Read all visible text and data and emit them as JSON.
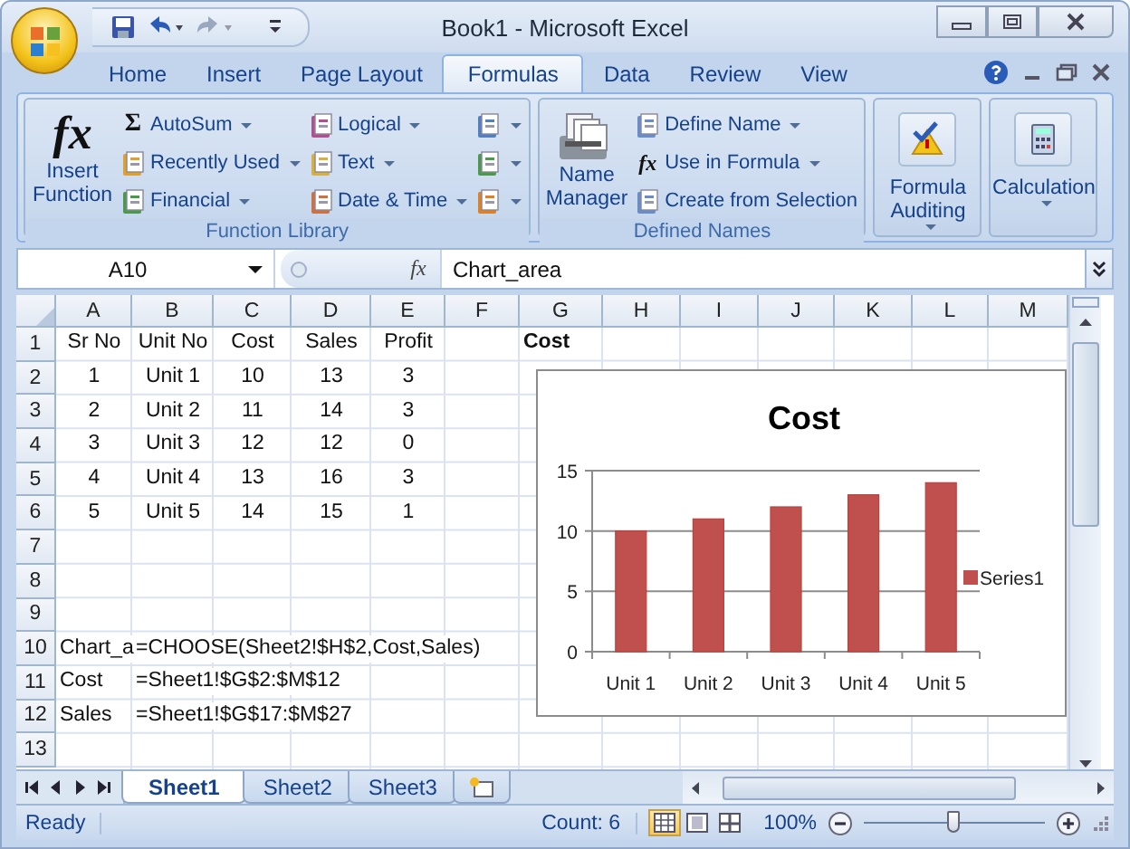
{
  "window": {
    "title": "Book1 - Microsoft Excel"
  },
  "ribbon_tabs": [
    {
      "label": "Home",
      "selected": false
    },
    {
      "label": "Insert",
      "selected": false
    },
    {
      "label": "Page Layout",
      "selected": false
    },
    {
      "label": "Formulas",
      "selected": true
    },
    {
      "label": "Data",
      "selected": false
    },
    {
      "label": "Review",
      "selected": false
    },
    {
      "label": "View",
      "selected": false
    }
  ],
  "ribbon_groups": [
    {
      "label": "Function Library",
      "large": [
        {
          "label": "Insert Function",
          "icon_text": "fx",
          "dropdown": false
        }
      ],
      "columns": [
        [
          {
            "label": "AutoSum",
            "icon_text": "Σ",
            "dropdown": true
          },
          {
            "label": "Recently Used",
            "dropdown": true
          },
          {
            "label": "Financial",
            "dropdown": true
          }
        ],
        [
          {
            "label": "Logical",
            "dropdown": true
          },
          {
            "label": "Text",
            "dropdown": true
          },
          {
            "label": "Date & Time",
            "dropdown": true
          }
        ],
        [
          {
            "dropdown": true
          },
          {
            "dropdown": true
          },
          {
            "dropdown": true
          }
        ]
      ]
    },
    {
      "label": "Defined Names",
      "large": [
        {
          "label": "Name Manager",
          "dropdown": false
        }
      ],
      "columns": [
        [
          {
            "label": "Define Name",
            "dropdown": true
          },
          {
            "label": "Use in Formula",
            "icon_text": "fx",
            "dropdown": true
          },
          {
            "label": "Create from Selection",
            "dropdown": false
          }
        ]
      ]
    },
    {
      "large": [
        {
          "label": "Formula Auditing",
          "dropdown": true
        }
      ]
    },
    {
      "large": [
        {
          "label": "Calculation",
          "dropdown": true
        }
      ]
    }
  ],
  "formula_bar": {
    "name_box": "A10",
    "fx": "fx",
    "value": "Chart_area"
  },
  "columns": [
    "A",
    "B",
    "C",
    "D",
    "E",
    "F",
    "G",
    "H",
    "I",
    "J",
    "K",
    "L",
    "M"
  ],
  "rows": [
    {
      "number": "1",
      "cells": {
        "A": {
          "text": "Sr No",
          "kind": "centered"
        },
        "B": {
          "text": "Unit No",
          "kind": "centered"
        },
        "C": {
          "text": "Cost",
          "kind": "centered"
        },
        "D": {
          "text": "Sales",
          "kind": "centered"
        },
        "E": {
          "text": "Profit",
          "kind": "centered"
        },
        "G": {
          "text": "Cost",
          "kind": "plain",
          "bold": true
        }
      }
    },
    {
      "number": "2",
      "cells": {
        "A": {
          "text": "1",
          "kind": "centered"
        },
        "B": {
          "text": "Unit 1",
          "kind": "centered"
        },
        "C": {
          "text": "10",
          "kind": "centered"
        },
        "D": {
          "text": "13",
          "kind": "centered"
        },
        "E": {
          "text": "3",
          "kind": "centered"
        }
      }
    },
    {
      "number": "3",
      "cells": {
        "A": {
          "text": "2",
          "kind": "centered"
        },
        "B": {
          "text": "Unit 2",
          "kind": "centered"
        },
        "C": {
          "text": "11",
          "kind": "centered"
        },
        "D": {
          "text": "14",
          "kind": "centered"
        },
        "E": {
          "text": "3",
          "kind": "centered"
        }
      }
    },
    {
      "number": "4",
      "cells": {
        "A": {
          "text": "3",
          "kind": "centered"
        },
        "B": {
          "text": "Unit 3",
          "kind": "centered"
        },
        "C": {
          "text": "12",
          "kind": "centered"
        },
        "D": {
          "text": "12",
          "kind": "centered"
        },
        "E": {
          "text": "0",
          "kind": "centered"
        }
      }
    },
    {
      "number": "5",
      "cells": {
        "A": {
          "text": "4",
          "kind": "centered"
        },
        "B": {
          "text": "Unit 4",
          "kind": "centered"
        },
        "C": {
          "text": "13",
          "kind": "centered"
        },
        "D": {
          "text": "16",
          "kind": "centered"
        },
        "E": {
          "text": "3",
          "kind": "centered"
        }
      }
    },
    {
      "number": "6",
      "cells": {
        "A": {
          "text": "5",
          "kind": "centered"
        },
        "B": {
          "text": "Unit 5",
          "kind": "centered"
        },
        "C": {
          "text": "14",
          "kind": "centered"
        },
        "D": {
          "text": "15",
          "kind": "centered"
        },
        "E": {
          "text": "1",
          "kind": "centered"
        }
      }
    },
    {
      "number": "7",
      "cells": {}
    },
    {
      "number": "8",
      "cells": {}
    },
    {
      "number": "9",
      "cells": {}
    },
    {
      "number": "10",
      "cells": {
        "A": {
          "text": "Chart_a",
          "kind": "plain"
        },
        "B": {
          "text": "=CHOOSE(Sheet2!$H$2,Cost,Sales)",
          "kind": "plain"
        }
      }
    },
    {
      "number": "11",
      "cells": {
        "A": {
          "text": "Cost",
          "kind": "plain"
        },
        "B": {
          "text": "=Sheet1!$G$2:$M$12",
          "kind": "plain"
        }
      }
    },
    {
      "number": "12",
      "cells": {
        "A": {
          "text": "Sales",
          "kind": "plain"
        },
        "B": {
          "text": "=Sheet1!$G$17:$M$27",
          "kind": "plain"
        }
      }
    },
    {
      "number": "13",
      "cells": {}
    }
  ],
  "chart": {
    "chart_data": {
      "type": "bar",
      "title": "Cost",
      "categories": [
        "Unit 1",
        "Unit 2",
        "Unit 3",
        "Unit 4",
        "Unit 5"
      ],
      "series": [
        {
          "name": "Series1",
          "color": "#c0504d",
          "values": [
            10,
            11,
            12,
            13,
            14
          ]
        }
      ],
      "ylim": [
        0,
        15
      ],
      "yticks": [
        0,
        5,
        10,
        15
      ]
    }
  },
  "sheet_tabs": [
    {
      "label": "Sheet1",
      "selected": true
    },
    {
      "label": "Sheet2",
      "selected": false
    },
    {
      "label": "Sheet3",
      "selected": false
    }
  ],
  "status_bar": {
    "mode": "Ready",
    "count": "Count: 6",
    "views": [
      {
        "selected": true
      },
      {
        "selected": false
      },
      {
        "selected": false
      }
    ],
    "zoom": "100%",
    "zoom_slider": {
      "level": 0.5
    }
  }
}
